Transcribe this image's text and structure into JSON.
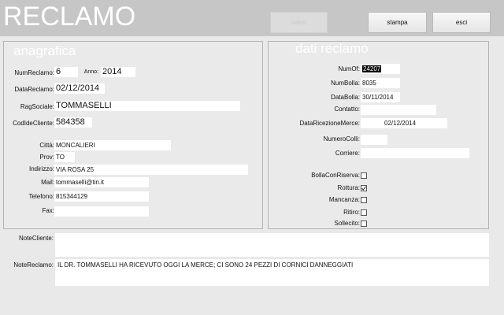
{
  "header": {
    "title": "RECLAMO",
    "buttons": {
      "disabled": "salva",
      "print": "stampa",
      "exit": "esci"
    }
  },
  "anagrafica": {
    "title": "anagrafica",
    "num_reclamo_label": "NumReclamo:",
    "num_reclamo": "6",
    "anno_label": "Anno:",
    "anno": "2014",
    "data_reclamo_label": "DataReclamo:",
    "data_reclamo": "02/12/2014",
    "rag_sociale_label": "RagSociale:",
    "rag_sociale": "TOMMASELLI",
    "cod_cliente_label": "CodIdeCliente:",
    "cod_cliente": "584358",
    "citta_label": "Città:",
    "citta": "MONCALIERI",
    "prov_label": "Prov:",
    "prov": "TO",
    "indirizzo_label": "Indirizzo:",
    "indirizzo": "VIA ROSA 25",
    "mail_label": "Mail:",
    "mail": "tommaselli@tin.it",
    "telefono_label": "Telefono:",
    "telefono": "815344129",
    "fax_label": "Fax:",
    "fax": ""
  },
  "dati_reclamo": {
    "title": "dati reclamo",
    "numof_label": "NumOf:",
    "numof": "24207",
    "numbolla_label": "NumBolla:",
    "numbolla": "8035",
    "databolla_label": "DataBolla:",
    "databolla": "30/11/2014",
    "contatto_label": "Contatto:",
    "contatto": "",
    "data_ricezione_label": "DataRicezioneMerce:",
    "data_ricezione": "02/12/2014",
    "numero_colli_label": "NumeroColli:",
    "numero_colli": "",
    "corriere_label": "Corriere:",
    "corriere": "",
    "checks": {
      "bolla_con_riserva_label": "BollaConRiserva:",
      "rottura_label": "Rottura:",
      "mancanza_label": "Mancanza:",
      "ritiro_label": "Ritiro:",
      "sollecito_label": "Sollecito:",
      "bolla_con_riserva": false,
      "rottura": true,
      "mancanza": false,
      "ritiro": false,
      "sollecito": false
    }
  },
  "notes": {
    "note_cliente_label": "NoteCliente:",
    "note_cliente": "",
    "note_reclamo_label": "NoteReclamo:",
    "note_reclamo": "IL DR. TOMMASELLI HA RICEVUTO OGGI LA MERCE; CI SONO 24 PEZZI DI CORNICI DANNEGGIATI"
  }
}
